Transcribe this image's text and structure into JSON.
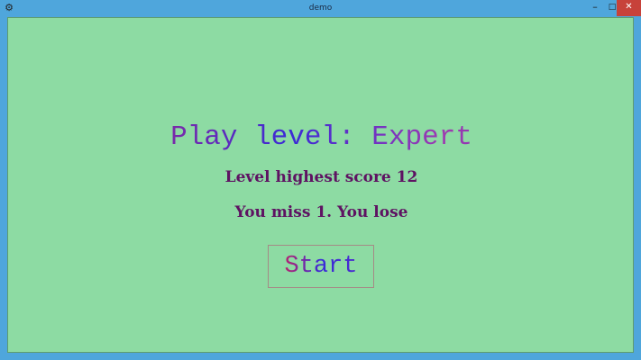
{
  "window": {
    "title": "demo",
    "app_icon": "app-icon",
    "controls": {
      "minimize": "–",
      "maximize": "□",
      "close": "✕"
    }
  },
  "game": {
    "headline": "Play level: Expert",
    "highest_score": "Level highest score 12",
    "result": "You miss 1. You lose",
    "start_label": "Start"
  },
  "colors": {
    "background": "#8ddba3",
    "title_bar": "#4fa6dc",
    "close_button": "#c7423a",
    "text_primary": "#5e1262",
    "text_accent": "#3b2ad6"
  }
}
